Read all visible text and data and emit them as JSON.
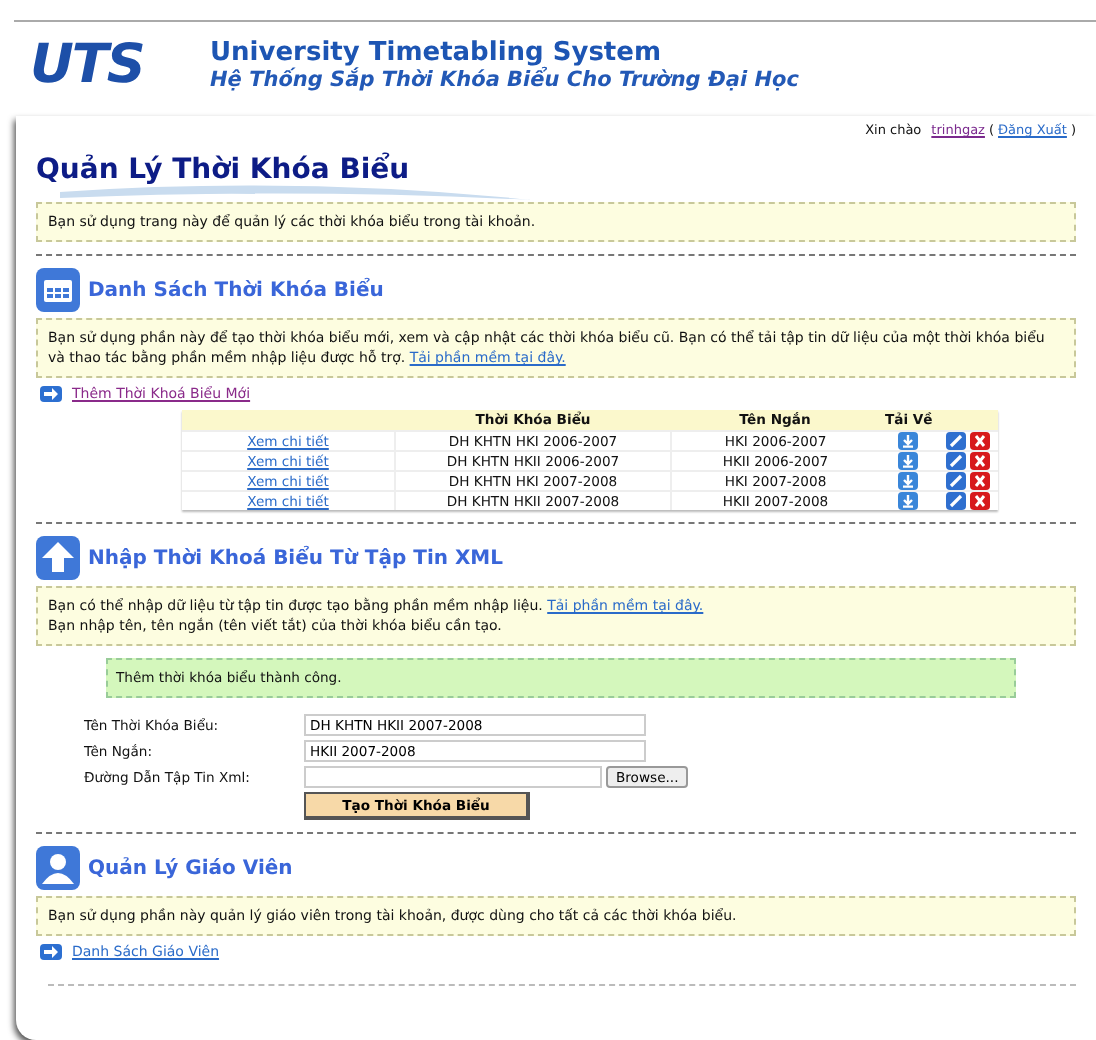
{
  "header": {
    "logo": "UTS",
    "title": "University Timetabling System",
    "subtitle": "Hệ Thống Sắp Thời Khóa Biểu Cho Trường Đại Học"
  },
  "user_bar": {
    "greeting": "Xin chào",
    "username": "trinhgaz",
    "open": "(",
    "logout": "Đăng Xuất",
    "close": ")"
  },
  "page_title": "Quản Lý Thời Khóa Biểu",
  "intro": "Bạn sử dụng trang này để quản lý các thời khóa biểu trong tài khoản.",
  "sections": [
    {
      "kind": "list",
      "title": "Danh Sách Thời Khóa Biểu",
      "info": [
        "Bạn sử dụng phần này để tạo thời khóa biểu mới, xem và cập nhật các thời khóa biểu cũ. Bạn có thể tải tập tin dữ liệu của một thời khóa biểu và thao tác bằng phần mềm nhập liệu được hỗ trợ."
      ],
      "info_link": "Tải phần mềm tại đây.",
      "action": "Thêm Thời Khoá Biểu Mới",
      "table": {
        "columns": [
          "Thời Khóa Biểu",
          "Tên Ngắn",
          "Tải Về"
        ],
        "rows": [
          {
            "link": "Xem chi tiết",
            "name": "DH KHTN HKI 2006-2007",
            "short": "HKI 2006-2007"
          },
          {
            "link": "Xem chi tiết",
            "name": "DH KHTN HKII 2006-2007",
            "short": "HKII 2006-2007"
          },
          {
            "link": "Xem chi tiết",
            "name": "DH KHTN HKI 2007-2008",
            "short": "HKI 2007-2008"
          },
          {
            "link": "Xem chi tiết",
            "name": "DH KHTN HKII 2007-2008",
            "short": "HKII 2007-2008"
          }
        ]
      }
    },
    {
      "kind": "import",
      "title": "Nhập Thời Khoá Biểu Từ Tập Tin XML",
      "info": [
        "Bạn có thể nhập dữ liệu từ tập tin được tạo bằng phần mềm nhập liệu.",
        "Bạn nhập tên, tên ngắn (tên viết tắt) của thời khóa biểu cần tạo."
      ],
      "info_link": "Tải phần mềm tại đây.",
      "success": "Thêm thời khóa biểu thành công.",
      "fields": [
        {
          "kind": "text",
          "label": "Tên Thời Khóa Biểu:",
          "value": "DH KHTN HKII 2007-2008"
        },
        {
          "kind": "text",
          "label": "Tên Ngắn:",
          "value": "HKII 2007-2008"
        },
        {
          "kind": "file",
          "label": "Đường Dẫn Tập Tin Xml:",
          "button": "Browse..."
        }
      ],
      "submit": "Tạo Thời Khóa Biểu"
    },
    {
      "kind": "teachers",
      "title": "Quản Lý Giáo Viên",
      "info": [
        "Bạn sử dụng phần này quản lý giáo viên trong tài khoản, được dùng cho tất cả các thời khóa biểu."
      ],
      "action": "Danh Sách Giáo Viên"
    }
  ]
}
